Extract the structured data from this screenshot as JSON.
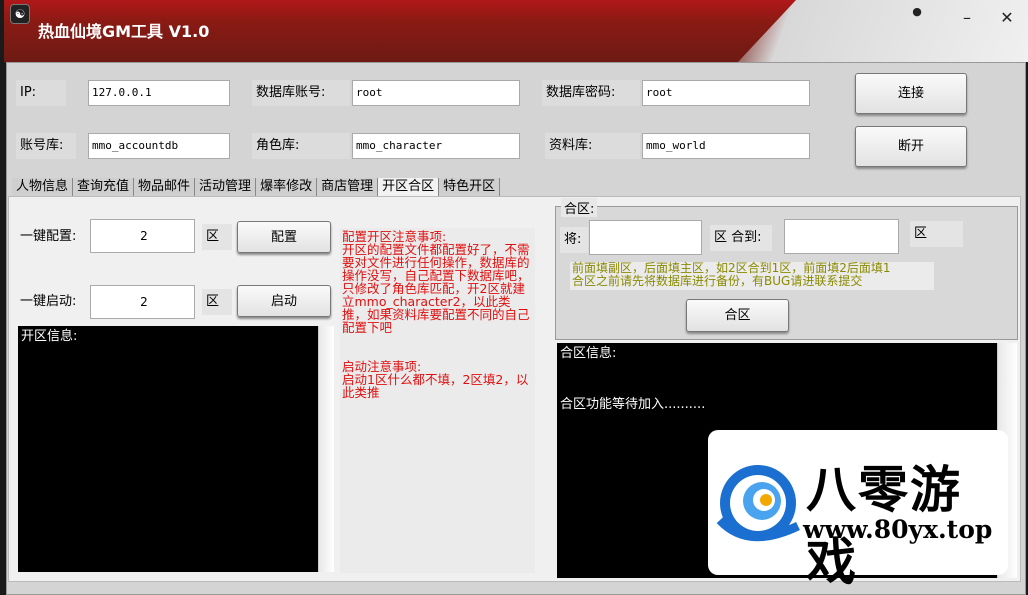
{
  "window": {
    "title": "热血仙境GM工具 V1.0",
    "minimize": "–",
    "close": "✕",
    "pin": "●"
  },
  "connection": {
    "ip_label": "IP:",
    "ip_value": "127.0.0.1",
    "db_user_label": "数据库账号:",
    "db_user_value": "root",
    "db_pass_label": "数据库密码:",
    "db_pass_value": "root",
    "account_db_label": "账号库:",
    "account_db_value": "mmo_accountdb",
    "role_db_label": "角色库:",
    "role_db_value": "mmo_character",
    "data_db_label": "资料库:",
    "data_db_value": "mmo_world",
    "connect": "连接",
    "disconnect": "断开"
  },
  "tabs": [
    {
      "label": "人物信息"
    },
    {
      "label": "查询充值"
    },
    {
      "label": "物品邮件"
    },
    {
      "label": "活动管理"
    },
    {
      "label": "爆率修改"
    },
    {
      "label": "商店管理"
    },
    {
      "label": "开区合区",
      "active": true
    },
    {
      "label": "特色开区"
    }
  ],
  "open_server": {
    "config_label": "一键配置:",
    "config_value": "2",
    "zone_unit": "区",
    "config_button": "配置",
    "start_label": "一键启动:",
    "start_value": "2",
    "start_button": "启动",
    "console": "开区信息:",
    "notes": "配置开区注意事项:\n开区的配置文件都配置好了，不需要对文件进行任何操作，数据库的操作没写，自己配置下数据库吧，只修改了角色库匹配，开2区就建立mmo_character2，以此类推，如果资料库要配置不同的自己配置下吧\n\n\n启动注意事项:\n启动1区什么都不填，2区填2，以此类推"
  },
  "merge": {
    "group_title": "合区:",
    "from_label": "将:",
    "from_value": "",
    "mid_label": "区 合到:",
    "to_value": "",
    "to_unit": "区",
    "hint": "前面填副区，后面填主区，如2区合到1区，前面填2后面填1\n合区之前请先将数据库进行备份，有BUG请进联系提交",
    "button": "合区",
    "console": "合区信息:\n\n\n合区功能等待加入.........."
  },
  "watermark": {
    "name": "八零游戏",
    "url": "www.80yx.top"
  },
  "colors": {
    "title_bar": "#7a1a14",
    "notes_text": "#e01010",
    "hint_text": "#8a8a00",
    "logo_blue": "#1a6fd0"
  }
}
